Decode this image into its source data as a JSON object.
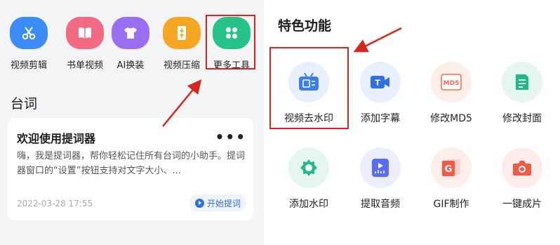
{
  "tools": [
    {
      "label": "视频剪辑",
      "icon": "scissors-icon",
      "color": "#3b8cf5"
    },
    {
      "label": "书单视频",
      "icon": "book-icon",
      "color": "#f36b82"
    },
    {
      "label": "AI换装",
      "icon": "shirt-icon",
      "color": "#9a6ef0"
    },
    {
      "label": "视频压缩",
      "icon": "compress-icon",
      "color": "#f5a623"
    },
    {
      "label": "更多工具",
      "icon": "grid-icon",
      "color": "#25c28a"
    }
  ],
  "teleprompter": {
    "section_title": "台词",
    "card_title": "欢迎使用提词器",
    "more": "•••",
    "description": "嗨，我是提词器，帮你轻松记住所有台词的小助手。提词器窗口的“设置”按钮支持对文字大小、...",
    "date": "2022-03-28 17:55",
    "start_button": "开始提词"
  },
  "features": {
    "title": "特色功能",
    "items": [
      {
        "label": "视频去水印",
        "icon": "tv-watermark-icon",
        "color": "#3b7cf0"
      },
      {
        "label": "添加字幕",
        "icon": "subtitle-icon",
        "color": "#2f6fe8"
      },
      {
        "label": "修改MD5",
        "icon": "md5-file-icon",
        "color": "#f56a4c"
      },
      {
        "label": "修改封面",
        "icon": "cover-icon",
        "color": "#20b887"
      },
      {
        "label": "添加水印",
        "icon": "watermark-drop-icon",
        "color": "#25b98a"
      },
      {
        "label": "提取音频",
        "icon": "audio-extract-icon",
        "color": "#5a6cf2"
      },
      {
        "label": "GIF制作",
        "icon": "gif-icon",
        "color": "#f55a48"
      },
      {
        "label": "一键成片",
        "icon": "camera-icon",
        "color": "#f25a48"
      }
    ]
  },
  "colors": {
    "annotation_red": "#d7261e",
    "accent_blue": "#2f6fde"
  }
}
